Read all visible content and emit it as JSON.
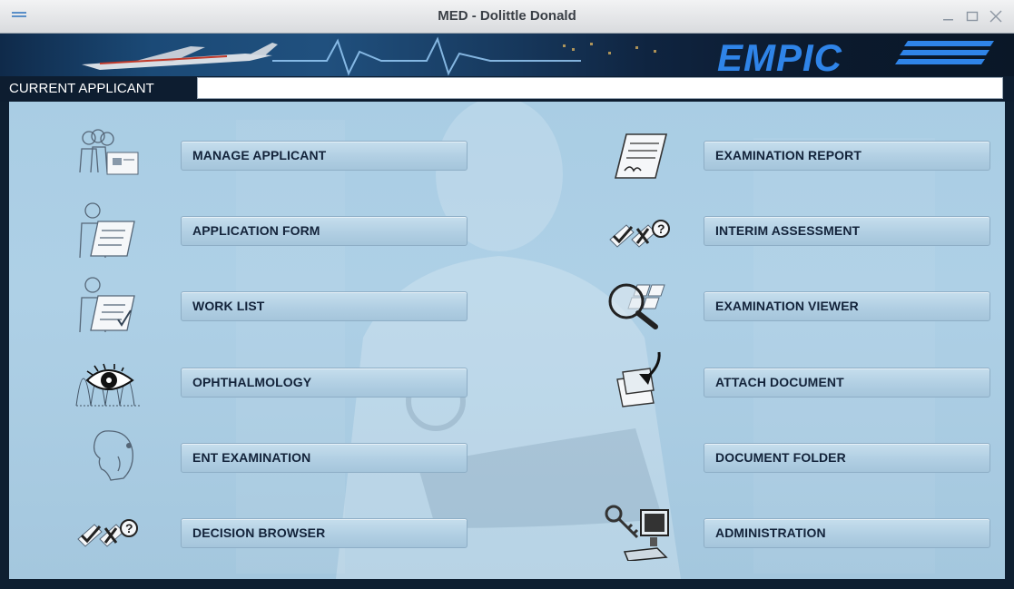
{
  "window": {
    "title": "MED - Dolittle Donald"
  },
  "banner": {
    "brand": "EMPIC"
  },
  "applicant_bar": {
    "label": "CURRENT APPLICANT",
    "value": ""
  },
  "menu_left": [
    {
      "label": "MANAGE APPLICANT",
      "icon": "applicant-group-icon"
    },
    {
      "label": "APPLICATION FORM",
      "icon": "application-form-icon"
    },
    {
      "label": "WORK LIST",
      "icon": "worklist-icon"
    },
    {
      "label": "OPHTHALMOLOGY",
      "icon": "eye-icon"
    },
    {
      "label": "ENT EXAMINATION",
      "icon": "head-ent-icon"
    },
    {
      "label": "DECISION BROWSER",
      "icon": "decision-marks-icon"
    }
  ],
  "menu_right": [
    {
      "label": "EXAMINATION REPORT",
      "icon": "report-document-icon"
    },
    {
      "label": "INTERIM ASSESSMENT",
      "icon": "assessment-marks-icon"
    },
    {
      "label": "EXAMINATION VIEWER",
      "icon": "magnifier-icon"
    },
    {
      "label": "ATTACH DOCUMENT",
      "icon": "attach-document-icon"
    },
    {
      "label": "DOCUMENT FOLDER",
      "icon": "document-folder-icon"
    },
    {
      "label": "ADMINISTRATION",
      "icon": "computer-key-icon"
    }
  ],
  "colors": {
    "brand_blue": "#2f84e8",
    "main_bg": "#a9cde4",
    "frame_dark": "#0e1f31"
  }
}
